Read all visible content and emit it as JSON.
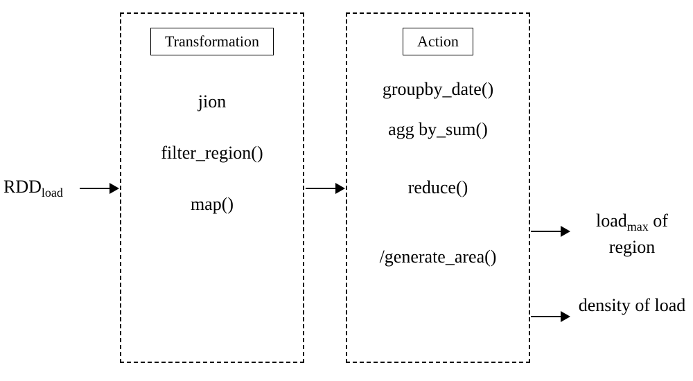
{
  "input": {
    "label_prefix": "RDD",
    "label_sub": "load"
  },
  "transformation": {
    "title": "Transformation",
    "items": [
      "jion",
      "filter_region()",
      "map()"
    ]
  },
  "action": {
    "title": "Action",
    "items": [
      "groupby_date()",
      "agg by_sum()",
      "reduce()",
      "/generate_area()"
    ]
  },
  "outputs": {
    "output1_prefix": "load",
    "output1_sub": "max",
    "output1_suffix": " of region",
    "output2": "density of load"
  }
}
